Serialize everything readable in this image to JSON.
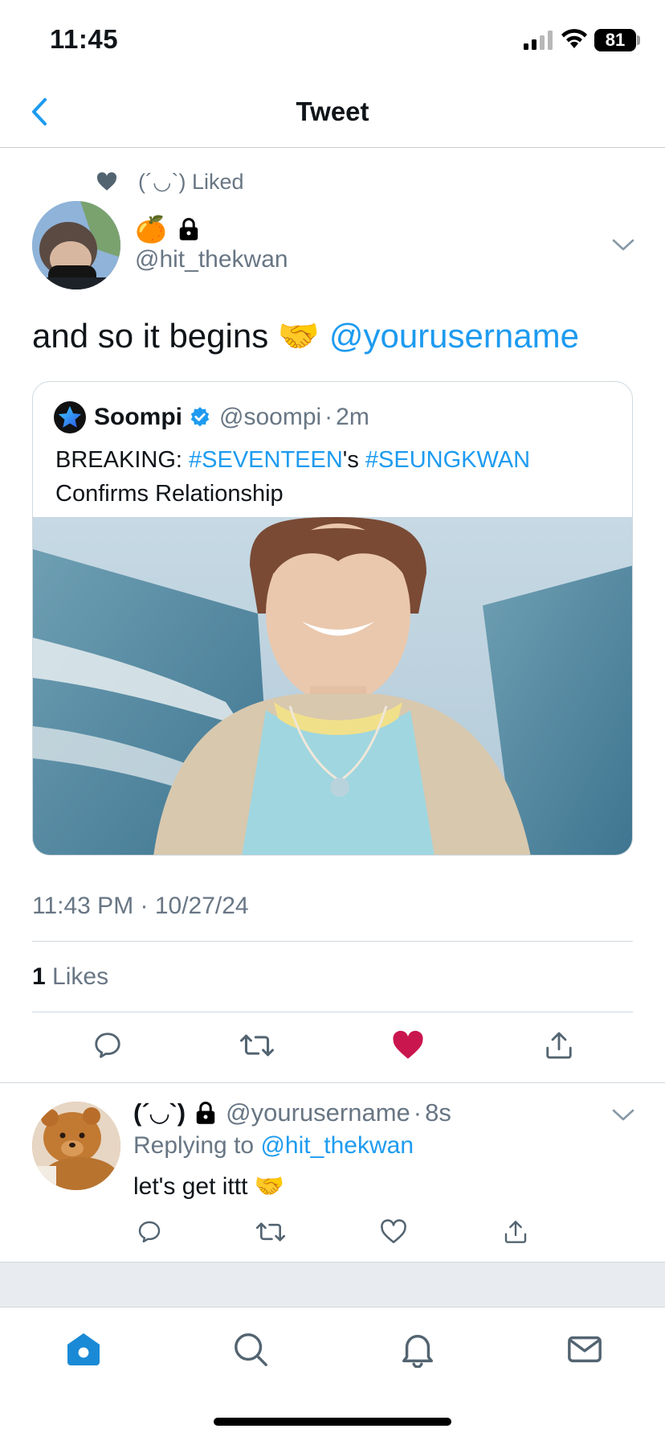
{
  "status_bar": {
    "time": "11:45",
    "battery": "81"
  },
  "header": {
    "title": "Tweet"
  },
  "tweet": {
    "liked_context": "(´◡`) Liked",
    "author_badges": [
      "🍊",
      "🔒"
    ],
    "author_handle": "@hit_thekwan",
    "text": "and so it begins 🤝",
    "mention": "@yourusername",
    "quote": {
      "name": "Soompi",
      "handle": "@soompi",
      "separator": "·",
      "age": "2m",
      "text_prefix": "BREAKING: ",
      "hashtag1": "#SEVENTEEN",
      "text_mid": "'s ",
      "hashtag2": "#SEUNGKWAN",
      "text_suffix": "Confirms Relationship"
    },
    "timestamp": "11:43 PM · 10/27/24",
    "likes_count": "1",
    "likes_label": "Likes",
    "liked": true
  },
  "reply": {
    "name": "(´◡`)",
    "handle": "@yourusername",
    "separator": "·",
    "age": "8s",
    "replying_to_label": "Replying to ",
    "replying_to_handle": "@hit_thekwan",
    "text": "let's get ittt 🤝"
  },
  "colors": {
    "accent": "#1d9bf0",
    "like": "#c9164f",
    "muted": "#687684",
    "tab_active": "#1a8ad6"
  },
  "tabs": [
    {
      "icon": "home-icon",
      "active": true
    },
    {
      "icon": "search-icon",
      "active": false
    },
    {
      "icon": "bell-icon",
      "active": false
    },
    {
      "icon": "mail-icon",
      "active": false
    }
  ]
}
